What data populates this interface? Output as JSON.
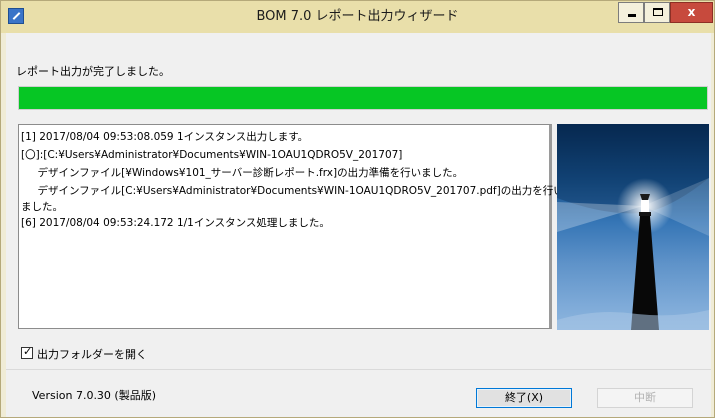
{
  "window": {
    "title": "BOM 7.0 レポート出力ウィザード",
    "controls": {
      "minimize": "minimize",
      "maximize": "maximize",
      "close": "x"
    }
  },
  "message": "レポート出力が完了しました。",
  "progress": {
    "value": 100,
    "color": "#06c624"
  },
  "log": [
    "[1] 2017/08/04 09:53:08.059 1インスタンス出力します。",
    "[〇]:[C:¥Users¥Administrator¥Documents¥WIN-1OAU1QDRO5V_201707]",
    "　デザインファイル[¥Windows¥101_サーバー診断レポート.frx]の出力準備を行いました。",
    "　デザインファイル[C:¥Users¥Administrator¥Documents¥WIN-1OAU1QDRO5V_201707.pdf]の出力を行い",
    "ました。",
    "[6] 2017/08/04 09:53:24.172 1/1インスタンス処理しました。"
  ],
  "options": {
    "open_folder_label": "出力フォルダーを開く",
    "open_folder_checked": true,
    "check_mark": "✓"
  },
  "footer": {
    "version": "Version 7.0.30 (製品版)",
    "finish_label": "終了(X)",
    "abort_label": "中断"
  },
  "icons": {
    "app": "wizard-app-icon",
    "lighthouse": "lighthouse-illustration"
  }
}
